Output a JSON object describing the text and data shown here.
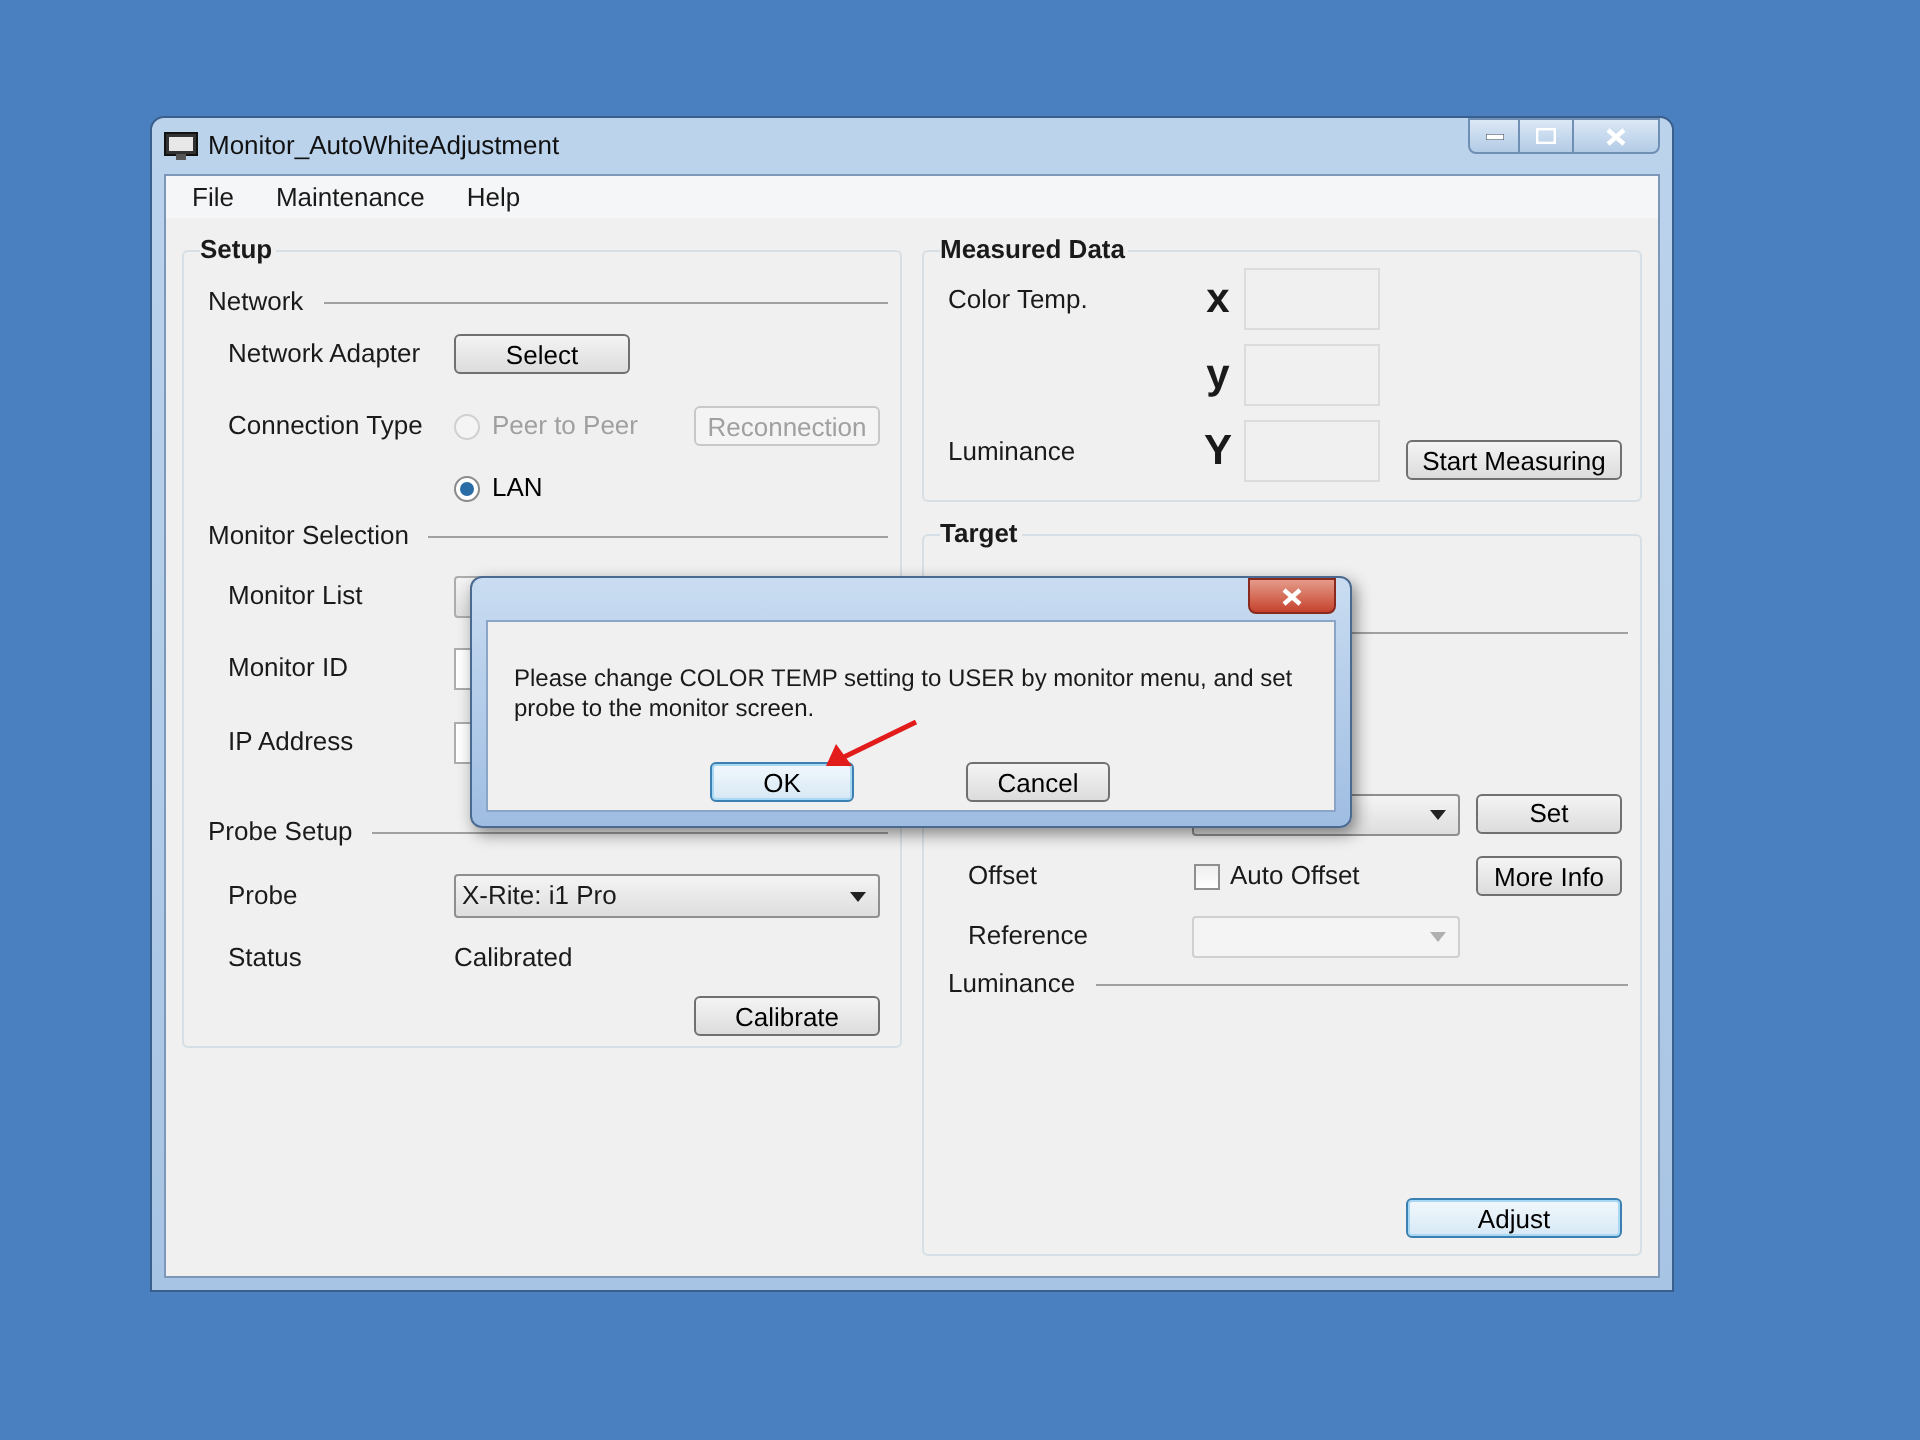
{
  "window": {
    "title": "Monitor_AutoWhiteAdjustment"
  },
  "menu": [
    "File",
    "Maintenance",
    "Help"
  ],
  "setup": {
    "title": "Setup",
    "network": {
      "title": "Network",
      "adapter_label": "Network Adapter",
      "select_button": "Select",
      "connection_label": "Connection Type",
      "options": [
        {
          "label": "Peer to Peer",
          "selected": false,
          "disabled": true
        },
        {
          "label": "LAN",
          "selected": true,
          "disabled": false
        }
      ],
      "reconnection_button": {
        "label": "Reconnection",
        "disabled": true
      }
    },
    "monitor_selection": {
      "title": "Monitor Selection",
      "fields": [
        {
          "label": "Monitor List",
          "kind": "combo"
        },
        {
          "label": "Monitor ID",
          "kind": "text"
        },
        {
          "label": "IP Address",
          "kind": "text"
        }
      ]
    },
    "probe_setup": {
      "title": "Probe Setup",
      "probe_label": "Probe",
      "probe_value": "X-Rite: i1 Pro",
      "status_label": "Status",
      "status_value": "Calibrated",
      "calibrate_button": "Calibrate"
    }
  },
  "measured_data": {
    "title": "Measured Data",
    "rows": [
      {
        "label": "Color Temp.",
        "symbol": "x"
      },
      {
        "symbol": "y"
      },
      {
        "label": "Luminance",
        "symbol": "Y"
      }
    ],
    "start_button": "Start Measuring"
  },
  "target": {
    "title": "Target",
    "set_button": "Set",
    "offset_label": "Offset",
    "auto_offset": {
      "label": "Auto Offset",
      "checked": false
    },
    "more_info_button": "More Info",
    "reference_label": "Reference",
    "reference_disabled": true,
    "luminance_title": "Luminance",
    "adjust_button": "Adjust"
  },
  "dialog": {
    "message": "Please change COLOR TEMP setting to USER by monitor menu, and set probe to the monitor screen.",
    "buttons": [
      {
        "label": "OK",
        "default": true
      },
      {
        "label": "Cancel",
        "default": false
      }
    ]
  }
}
